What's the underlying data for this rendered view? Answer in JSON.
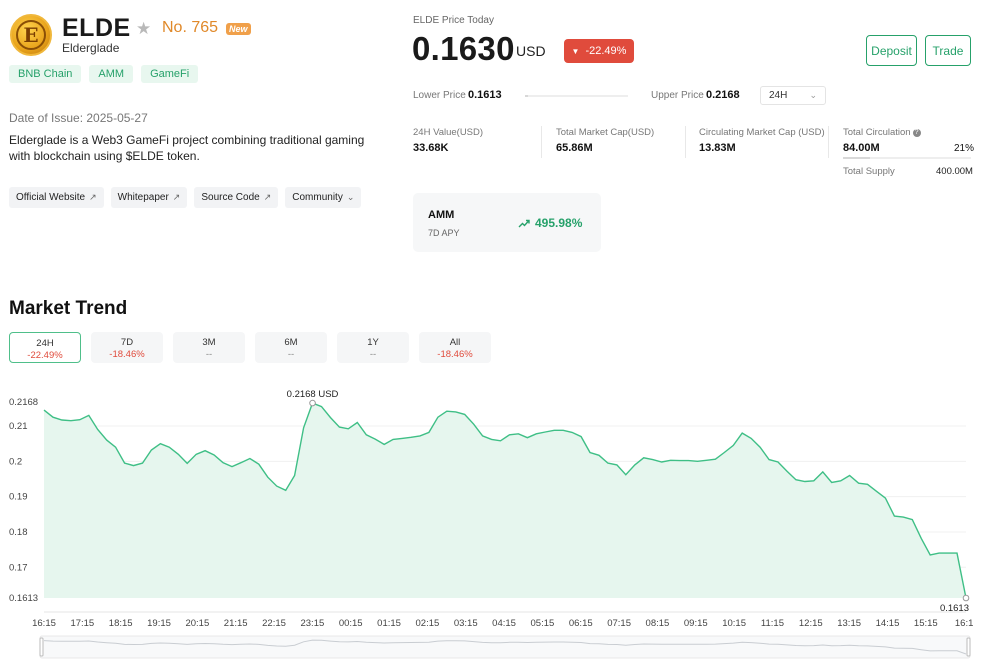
{
  "token": {
    "logo_letter": "E",
    "symbol": "ELDE",
    "name": "Elderglade",
    "rank": "No. 765",
    "badge": "New",
    "tags": [
      "BNB Chain",
      "AMM",
      "GameFi"
    ],
    "issue_date": "Date of Issue: 2025-05-27",
    "description": "Elderglade is a Web3 GameFi project combining traditional gaming with blockchain using $ELDE token.",
    "links": [
      "Official Website",
      "Whitepaper",
      "Source Code",
      "Community"
    ]
  },
  "price": {
    "title": "ELDE Price Today",
    "value": "0.1630",
    "currency": "USD",
    "change": "-22.49%",
    "lower_label": "Lower Price",
    "lower_value": "0.1613",
    "upper_label": "Upper Price",
    "upper_value": "0.2168",
    "range_position": 0.03,
    "period": "24H"
  },
  "actions": {
    "deposit": "Deposit",
    "trade": "Trade"
  },
  "stats": {
    "value_label": "24H Value(USD)",
    "value": "33.68K",
    "mcap_label": "Total Market Cap(USD)",
    "mcap": "65.86M",
    "circ_mcap_label": "Circulating Market Cap (USD)",
    "circ_mcap": "13.83M",
    "circulation_label": "Total Circulation",
    "circulation": "84.00M",
    "circulation_pct": "21%",
    "circulation_fraction": 0.21,
    "supply_label": "Total Supply",
    "supply": "400.00M"
  },
  "amm": {
    "name": "AMM",
    "sub": "7D APY",
    "apy": "495.98%"
  },
  "market_trend": {
    "title": "Market Trend",
    "tabs": [
      {
        "label": "24H",
        "change": "-22.49%"
      },
      {
        "label": "7D",
        "change": "-18.46%"
      },
      {
        "label": "3M",
        "change": "--"
      },
      {
        "label": "6M",
        "change": "--"
      },
      {
        "label": "1Y",
        "change": "--"
      },
      {
        "label": "All",
        "change": "-18.46%"
      }
    ]
  },
  "chart_data": {
    "type": "area",
    "ylim": [
      0.1613,
      0.2168
    ],
    "y_ticks": [
      "0.2168",
      "0.21",
      "0.2",
      "0.19",
      "0.18",
      "0.17",
      "0.1613"
    ],
    "x_ticks": [
      "16:15",
      "17:15",
      "18:15",
      "19:15",
      "20:15",
      "21:15",
      "22:15",
      "23:15",
      "00:15",
      "01:15",
      "02:15",
      "03:15",
      "04:15",
      "05:15",
      "06:15",
      "07:15",
      "08:15",
      "09:15",
      "10:15",
      "11:15",
      "12:15",
      "13:15",
      "14:15",
      "15:15",
      "16:1"
    ],
    "max_label": "0.2168 USD",
    "last_label": "0.1613",
    "series": [
      {
        "values": [
          0.2145,
          0.2125,
          0.2117,
          0.2115,
          0.2118,
          0.213,
          0.209,
          0.206,
          0.204,
          0.1995,
          0.1988,
          0.1995,
          0.2032,
          0.205,
          0.204,
          0.202,
          0.1994,
          0.202,
          0.203,
          0.2018,
          0.1996,
          0.1985,
          0.1996,
          0.2008,
          0.1992,
          0.1955,
          0.193,
          0.1918,
          0.196,
          0.2095,
          0.2165,
          0.2155,
          0.2124,
          0.2097,
          0.2092,
          0.211,
          0.2075,
          0.2063,
          0.2048,
          0.2062,
          0.2065,
          0.2068,
          0.2072,
          0.2082,
          0.2125,
          0.2142,
          0.214,
          0.2133,
          0.2105,
          0.2072,
          0.2062,
          0.2058,
          0.2075,
          0.2078,
          0.2067,
          0.2078,
          0.2083,
          0.2088,
          0.2088,
          0.2082,
          0.207,
          0.2025,
          0.2017,
          0.1995,
          0.199,
          0.1962,
          0.199,
          0.201,
          0.2005,
          0.1998,
          0.2003,
          0.2002,
          0.2002,
          0.2,
          0.2003,
          0.2006,
          0.2025,
          0.2045,
          0.208,
          0.2065,
          0.204,
          0.2005,
          0.1998,
          0.1972,
          0.1948,
          0.1943,
          0.1945,
          0.197,
          0.194,
          0.1945,
          0.196,
          0.1938,
          0.1935,
          0.1915,
          0.1896,
          0.1845,
          0.1842,
          0.1835,
          0.1782,
          0.1735,
          0.174,
          0.174,
          0.174,
          0.1613
        ],
        "x_positions": [
          0,
          0.2,
          0.4,
          0.6,
          0.8,
          1.0,
          1.2,
          1.4,
          1.6,
          1.8,
          2.0,
          2.2,
          2.4,
          2.6,
          2.8,
          3.0,
          3.2,
          3.4,
          3.6,
          3.8,
          4.0,
          4.2,
          4.4,
          4.6,
          4.8,
          5.0,
          5.2,
          5.4,
          5.6,
          5.8,
          6.0,
          6.2,
          6.4,
          6.6,
          6.8,
          7.0,
          7.2,
          7.4,
          7.6,
          7.8,
          8.0,
          8.2,
          8.4,
          8.6,
          8.8,
          9.0,
          9.2,
          9.4,
          9.6,
          9.8,
          10.0,
          10.2,
          10.4,
          10.6,
          10.8,
          11.0,
          11.2,
          11.4,
          11.6,
          11.8,
          12.0,
          12.2,
          12.4,
          12.6,
          12.8,
          13.0,
          13.2,
          13.4,
          13.6,
          13.8,
          14.0,
          14.2,
          14.4,
          14.6,
          14.8,
          15.0,
          15.2,
          15.4,
          15.6,
          15.8,
          16.0,
          16.2,
          16.4,
          16.6,
          16.8,
          17.0,
          17.2,
          17.4,
          17.6,
          17.8,
          18.0,
          18.2,
          18.4,
          18.6,
          18.8,
          19.0,
          19.2,
          19.4,
          19.6,
          19.8,
          20.0,
          20.2,
          20.4,
          20.6
        ]
      }
    ],
    "colors": {
      "line": "#3fbf86",
      "fill": "#e6f6ee"
    }
  }
}
